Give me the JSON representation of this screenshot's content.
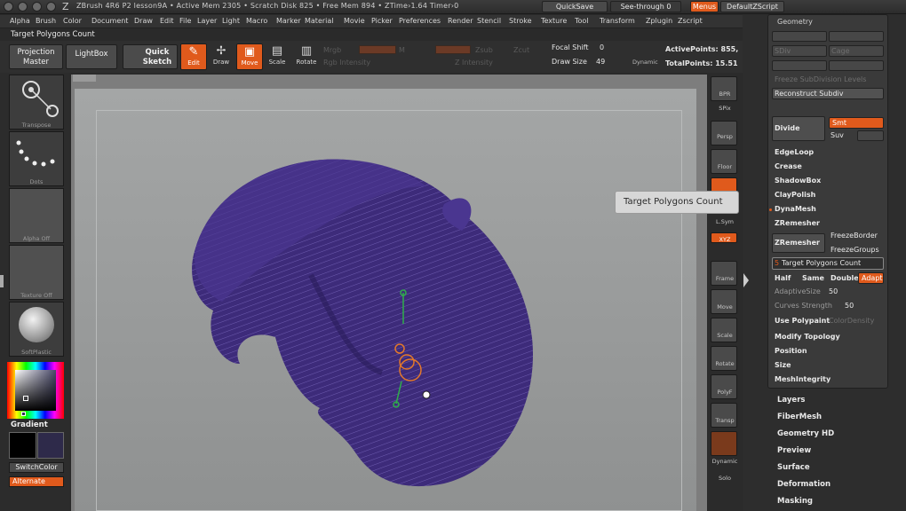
{
  "titlebar": {
    "title": "ZBrush 4R6 P2    lesson9A    • Active Mem 2305 • Scratch Disk 825 • Free Mem 894 • ZTime›1.64 Timer›0",
    "quicksave": "QuickSave",
    "seethrough": "See-through  0",
    "menus": "Menus",
    "script": "DefaultZScript"
  },
  "menubar": [
    "Alpha",
    "Brush",
    "Color",
    "Document",
    "Draw",
    "Edit",
    "File",
    "Layer",
    "Light",
    "Macro",
    "Marker",
    "Material",
    "Movie",
    "Picker",
    "Preferences",
    "Render",
    "Stencil",
    "Stroke",
    "Texture",
    "Tool",
    "Transform",
    "Zplugin",
    "Zscript"
  ],
  "subtitle": "Target Polygons Count",
  "toolbar": {
    "projection_master": "Projection\nMaster",
    "lightbox": "LightBox",
    "quick_sketch": "Quick\nSketch",
    "edit": "Edit",
    "draw": "Draw",
    "move": "Move",
    "scale": "Scale",
    "rotate": "Rotate",
    "mrgb": "Mrgb",
    "rgb": "Rgb",
    "m": "M",
    "zsub": "Zsub",
    "zcut": "Zcut",
    "rgb_intensity": "Rgb Intensity",
    "z_intensity": "Z Intensity",
    "focal_shift_label": "Focal Shift",
    "focal_shift_value": "0",
    "draw_size_label": "Draw Size",
    "draw_size_value": "49",
    "dynamic": "Dynamic",
    "active_points": "ActivePoints: 855,",
    "total_points": "TotalPoints: 15.51"
  },
  "leftshelf": {
    "transpose": "Transpose",
    "dots": "Dots",
    "alpha_off": "Alpha Off",
    "texture_off": "Texture Off",
    "material": "SoftPlastic",
    "gradient": "Gradient",
    "switchcolor": "SwitchColor",
    "alternate": "Alternate"
  },
  "rightstrip": [
    "BPR",
    "SPix",
    "Persp",
    "Floor",
    "Local",
    "L.Sym",
    "XYZ",
    "Frame",
    "Move",
    "Scale",
    "Rotate",
    "PolyF",
    "Transp",
    "Dynamic",
    "Solo"
  ],
  "tooltip": "Target Polygons Count",
  "geometry": {
    "header": "Geometry",
    "sdiv": "SDiv",
    "cage": "Cage",
    "freeze": "Freeze SubDivision Levels",
    "reconstruct": "Reconstruct Subdiv",
    "divide": "Divide",
    "smt": "Smt",
    "suv": "Suv",
    "items": [
      "EdgeLoop",
      "Crease",
      "ShadowBox",
      "ClayPolish",
      "DynaMesh",
      "ZRemesher"
    ],
    "zremesher_btn": "ZRemesher",
    "freeze_border": "FreezeBorder",
    "freeze_groups": "FreezeGroups",
    "target_polys": "Target Polygons Count",
    "target_value": "5",
    "half": "Half",
    "same": "Same",
    "double": "Double",
    "adapt": "Adapt",
    "adaptive_size_label": "AdaptiveSize",
    "adaptive_size_value": "50",
    "curves_strength_label": "Curves Strength",
    "curves_strength_value": "50",
    "use_polypaint": "Use Polypaint",
    "color_density": "ColorDensity",
    "modify_topology": "Modify Topology",
    "position": "Position",
    "size": "Size",
    "meshintegrity": "MeshIntegrity"
  },
  "panels": [
    "Layers",
    "FiberMesh",
    "Geometry HD",
    "Preview",
    "Surface",
    "Deformation",
    "Masking"
  ],
  "colors": {
    "accent": "#e05a1c",
    "hair": "#3d2b7a"
  }
}
